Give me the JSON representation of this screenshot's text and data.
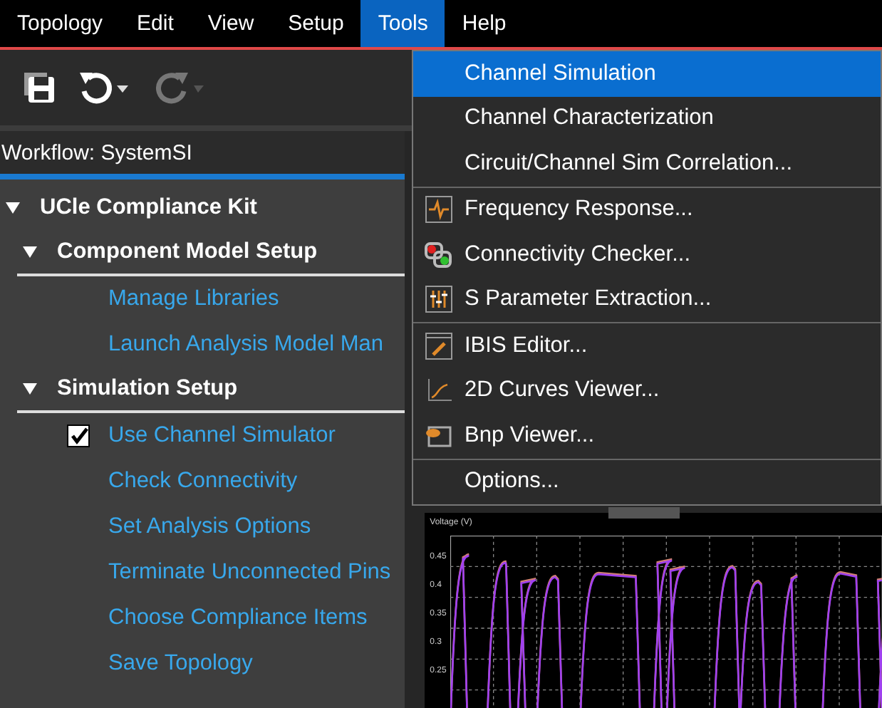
{
  "menu_bar": [
    {
      "label": "Topology",
      "selected": false
    },
    {
      "label": "Edit",
      "selected": false
    },
    {
      "label": "View",
      "selected": false
    },
    {
      "label": "Setup",
      "selected": false
    },
    {
      "label": "Tools",
      "selected": true
    },
    {
      "label": "Help",
      "selected": false
    }
  ],
  "workflow": {
    "title": "Workflow: SystemSI"
  },
  "tree": {
    "label": "UCle Compliance Kit",
    "expanded": true,
    "children": [
      {
        "label": "Component Model Setup",
        "expanded": true,
        "children": [
          {
            "label": "Manage Libraries"
          },
          {
            "label": "Launch Analysis Model Man"
          }
        ]
      },
      {
        "label": "Simulation Setup",
        "expanded": true,
        "children": [
          {
            "label": "Use Channel Simulator",
            "checked": true
          },
          {
            "label": "Check Connectivity"
          },
          {
            "label": "Set Analysis Options"
          },
          {
            "label": "Terminate Unconnected Pins"
          },
          {
            "label": "Choose Compliance Items"
          },
          {
            "label": "Save Topology"
          }
        ]
      }
    ]
  },
  "tools_menu": {
    "groups": [
      [
        {
          "label": "Channel Simulation",
          "selected": true
        },
        {
          "label": "Channel Characterization",
          "selected": false
        },
        {
          "label": "Circuit/Channel Sim Correlation...",
          "selected": false
        }
      ],
      [
        {
          "label": "Frequency Response...",
          "selected": false,
          "kind": "pulse"
        },
        {
          "label": "Connectivity Checker...",
          "selected": false,
          "kind": "link"
        },
        {
          "label": "S Parameter Extraction...",
          "selected": false,
          "kind": "sliders"
        }
      ],
      [
        {
          "label": "IBIS Editor...",
          "selected": false,
          "kind": "editor"
        },
        {
          "label": "2D Curves Viewer...",
          "selected": false,
          "kind": "curve"
        },
        {
          "label": "Bnp Viewer...",
          "selected": false,
          "kind": "eye"
        }
      ],
      [
        {
          "label": "Options...",
          "selected": false
        }
      ]
    ]
  },
  "waveform_panel": {
    "ylabel": "Voltage (V)",
    "tick_labels": [
      "0.45",
      "0.4",
      "0.35",
      "0.3",
      "0.25"
    ]
  }
}
